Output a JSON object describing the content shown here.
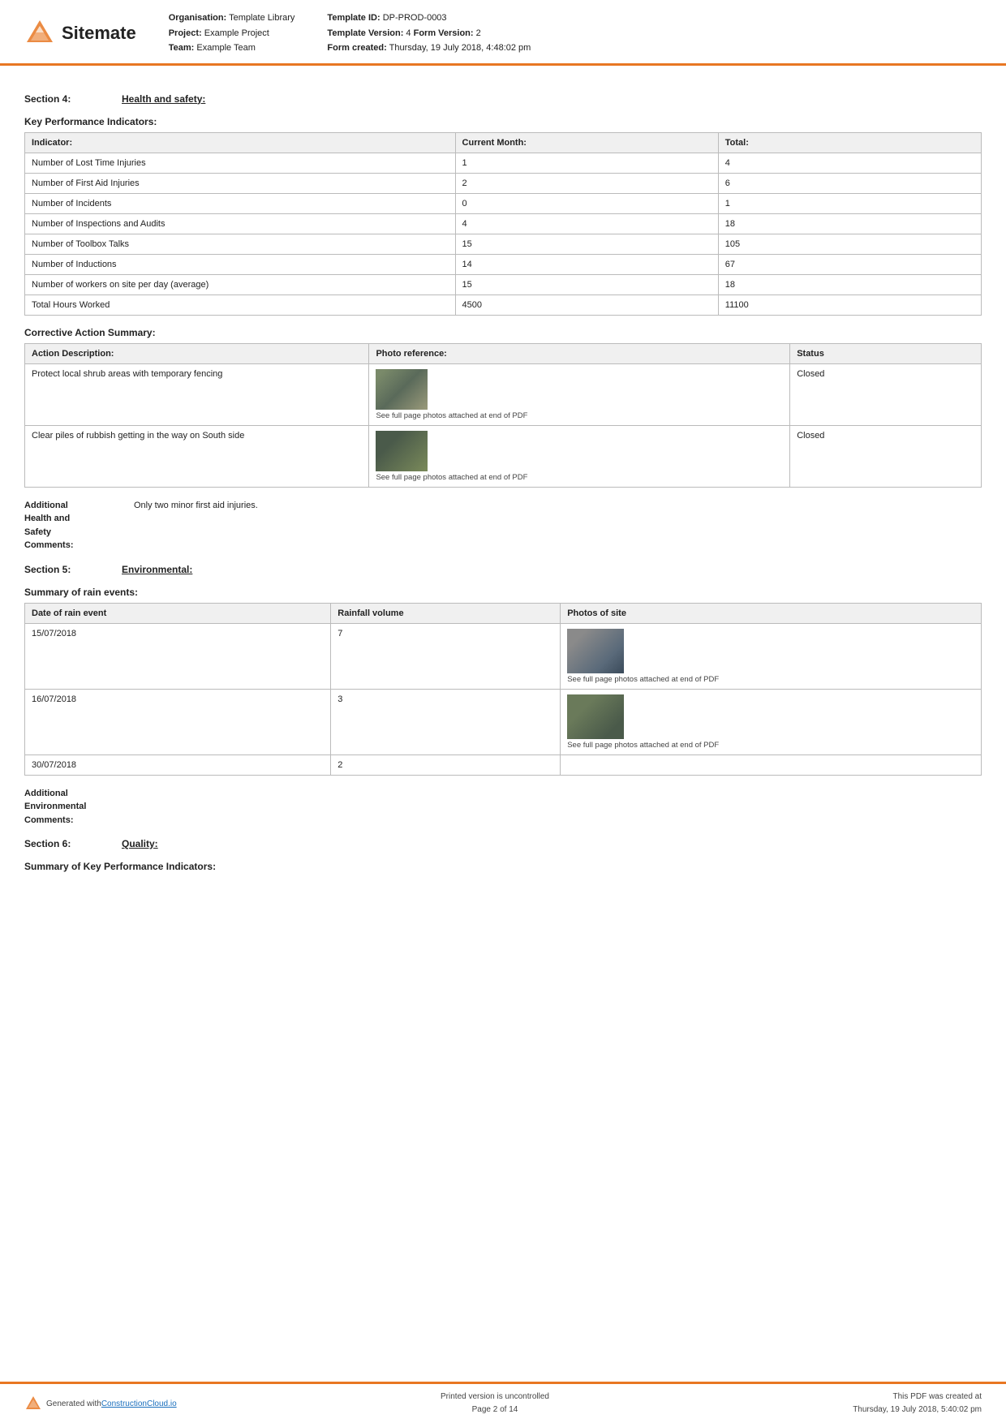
{
  "header": {
    "logo_text": "Sitemate",
    "org_label": "Organisation:",
    "org_value": "Template Library",
    "project_label": "Project:",
    "project_value": "Example Project",
    "team_label": "Team:",
    "team_value": "Example Team",
    "template_id_label": "Template ID:",
    "template_id_value": "DP-PROD-0003",
    "template_version_label": "Template Version:",
    "template_version_value": "4",
    "form_version_label": "Form Version:",
    "form_version_value": "2",
    "form_created_label": "Form created:",
    "form_created_value": "Thursday, 19 July 2018, 4:48:02 pm"
  },
  "section4": {
    "label": "Section 4:",
    "title": "Health and safety:"
  },
  "kpi": {
    "section_title": "Key Performance Indicators:",
    "col1": "Indicator:",
    "col2": "Current Month:",
    "col3": "Total:",
    "rows": [
      {
        "indicator": "Number of Lost Time Injuries",
        "current": "1",
        "total": "4"
      },
      {
        "indicator": "Number of First Aid Injuries",
        "current": "2",
        "total": "6"
      },
      {
        "indicator": "Number of Incidents",
        "current": "0",
        "total": "1"
      },
      {
        "indicator": "Number of Inspections and Audits",
        "current": "4",
        "total": "18"
      },
      {
        "indicator": "Number of Toolbox Talks",
        "current": "15",
        "total": "105"
      },
      {
        "indicator": "Number of Inductions",
        "current": "14",
        "total": "67"
      },
      {
        "indicator": "Number of workers on site per day (average)",
        "current": "15",
        "total": "18"
      },
      {
        "indicator": "Total Hours Worked",
        "current": "4500",
        "total": "11100"
      }
    ]
  },
  "corrective": {
    "section_title": "Corrective Action Summary:",
    "col1": "Action Description:",
    "col2": "Photo reference:",
    "col3": "Status",
    "rows": [
      {
        "description": "Protect local shrub areas with temporary fencing",
        "photo_caption": "See full page photos attached at end of PDF",
        "status": "Closed"
      },
      {
        "description": "Clear piles of rubbish getting in the way on South side",
        "photo_caption": "See full page photos attached at end of PDF",
        "status": "Closed"
      }
    ]
  },
  "additional_hs": {
    "label": "Additional\nHealth and\nSafety\nComments:",
    "value": "Only two minor first aid injuries."
  },
  "section5": {
    "label": "Section 5:",
    "title": "Environmental:"
  },
  "rain": {
    "section_title": "Summary of rain events:",
    "col1": "Date of rain event",
    "col2": "Rainfall volume",
    "col3": "Photos of site",
    "rows": [
      {
        "date": "15/07/2018",
        "volume": "7",
        "photo_caption": "See full page photos attached at end of PDF",
        "has_photo": true
      },
      {
        "date": "16/07/2018",
        "volume": "3",
        "photo_caption": "See full page photos attached at end of PDF",
        "has_photo": true
      },
      {
        "date": "30/07/2018",
        "volume": "2",
        "photo_caption": "",
        "has_photo": false
      }
    ]
  },
  "additional_env": {
    "label": "Additional\nEnvironmental\nComments:"
  },
  "section6": {
    "label": "Section 6:",
    "title": "Quality:"
  },
  "section6_sub": {
    "section_title": "Summary of Key Performance Indicators:"
  },
  "footer": {
    "generated_label": "Generated with ",
    "generated_link": "ConstructionCloud.io",
    "center_line1": "Printed version is uncontrolled",
    "center_line2": "Page 2 of 14",
    "right_line1": "This PDF was created at",
    "right_line2": "Thursday, 19 July 2018, 5:40:02 pm"
  }
}
